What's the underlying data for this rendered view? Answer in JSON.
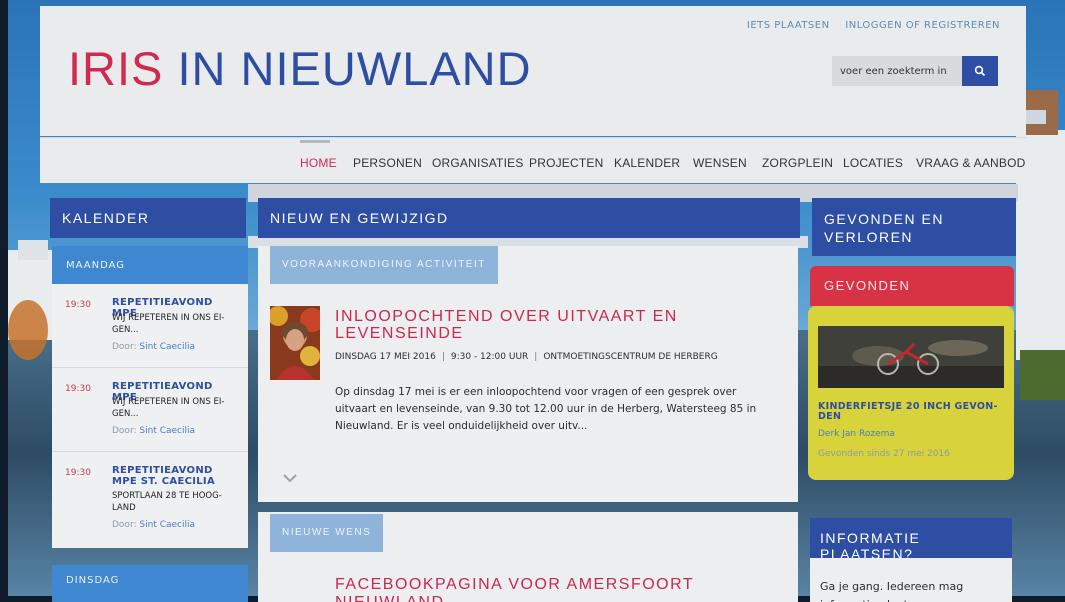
{
  "site": {
    "logo_part1": "IRIS",
    "logo_part2": "IN NIEUWLAND",
    "top_links": [
      "IETS PLAATSEN",
      "INLOGGEN OF REGISTREREN"
    ],
    "search_placeholder": "voer een zoekterm in"
  },
  "nav": {
    "items": [
      "HOME",
      "PERSONEN",
      "ORGANISATIES",
      "PROJECTEN",
      "KALENDER",
      "WENSEN",
      "ZORGPLEIN",
      "LOCATIES",
      "VRAAG & AANBOD"
    ],
    "active": "HOME"
  },
  "calendar": {
    "heading": "KALENDER",
    "day1": "MAANDAG",
    "events": [
      {
        "time": "19:30",
        "title": "REPETITIEAVOND MPE",
        "desc": "WIJ REPETEREN IN ONS EI-GEN...",
        "by_label": "Door:",
        "by": "Sint Caecilia"
      },
      {
        "time": "19:30",
        "title": "REPETITIEAVOND MPE",
        "desc": "WIJ REPETEREN IN ONS EI-GEN...",
        "by_label": "Door:",
        "by": "Sint Caecilia"
      },
      {
        "time": "19:30",
        "title": "REPETITIEAVOND MPE ST. CAECILIA",
        "desc": "SPORTLAAN 28 TE HOOG-LAND",
        "by_label": "Door:",
        "by": "Sint Caecilia"
      }
    ],
    "day2": "DINSDAG"
  },
  "news": {
    "heading": "NIEUW EN GEWIJZIGD",
    "item1": {
      "tag": "VOORAANKONDIGING ACTIVITEIT",
      "title": "INLOOPOCHTEND OVER UITVAART EN LEVENSEINDE",
      "date": "DINSDAG 17 MEI 2016",
      "time": "9:30 - 12:00 UUR",
      "location": "ONTMOETINGSCENTRUM DE HERBERG",
      "body": "Op dinsdag 17 mei is er een inloopochtend voor vragen of een gesprek over uitvaart en levenseinde, van 9.30 tot 12.00 uur in de Herberg, Watersteeg 85 in Nieuwland. Er is veel onduidelijkheid over uitv..."
    },
    "item2": {
      "tag": "NIEUWE WENS",
      "title": "FACEBOOKPAGINA VOOR AMERSFOORT NIEUWLAND"
    }
  },
  "lost_found": {
    "heading": "GEVONDEN EN VERLOREN",
    "section": "GEVONDEN",
    "item_title": "KINDERFIETSJE 20 INCH GEVON-DEN",
    "item_by": "Derk Jan Rozema",
    "item_since": "Gevonden sinds 27 mei 2016"
  },
  "info": {
    "heading": "INFORMATIE PLAATSEN?",
    "body": "Ga je gang. Iedereen mag informatie plaatsen op..."
  },
  "colors": {
    "brand_blue": "#2d4ea3",
    "brand_red": "#d12a4f",
    "found_yellow": "#d9d33b"
  }
}
